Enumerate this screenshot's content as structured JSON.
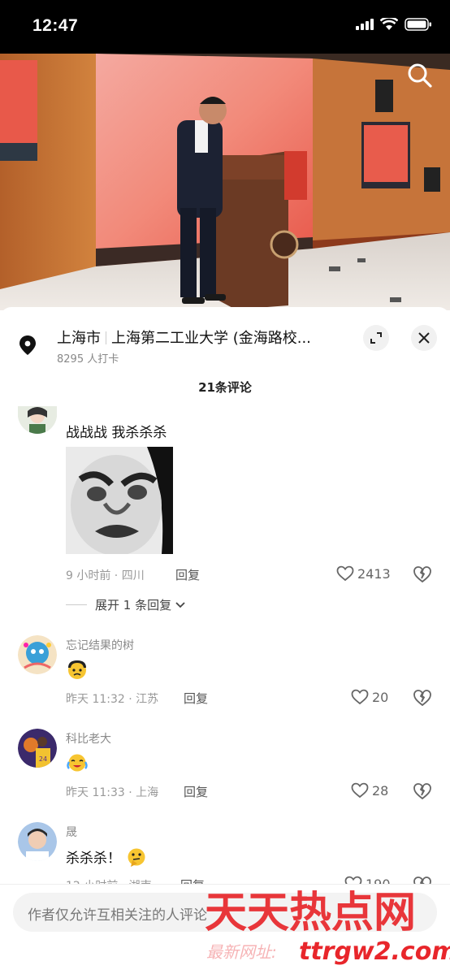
{
  "status": {
    "time": "12:47"
  },
  "location": {
    "city": "上海市",
    "place": "上海第二工业大学 (金海路校...",
    "checkins": "8295 人打卡"
  },
  "comments_header": "21条评论",
  "comments": [
    {
      "username": "",
      "text": "战战战 我杀杀杀",
      "meta": "9 小时前 · 四川",
      "reply": "回复",
      "likes": "2413",
      "expand": "展开 1 条回复"
    },
    {
      "username": "忘记结果的树",
      "text": "",
      "meta": "昨天 11:32 · 江苏",
      "reply": "回复",
      "likes": "20"
    },
    {
      "username": "科比老大",
      "text": "",
      "meta": "昨天 11:33 · 上海",
      "reply": "回复",
      "likes": "28"
    },
    {
      "username": "晟",
      "text": "杀杀杀！",
      "meta": "12 小时前 · 湖南",
      "reply": "回复",
      "likes": "190"
    }
  ],
  "input": {
    "placeholder": "作者仅允许互相关注的人评论"
  },
  "watermark": {
    "brand": "天天热点网",
    "url_label": "最新网址:",
    "url": "ttrgw2.com"
  },
  "colors": {
    "watermark_red": "#e8262b",
    "like_gray": "#666666"
  }
}
